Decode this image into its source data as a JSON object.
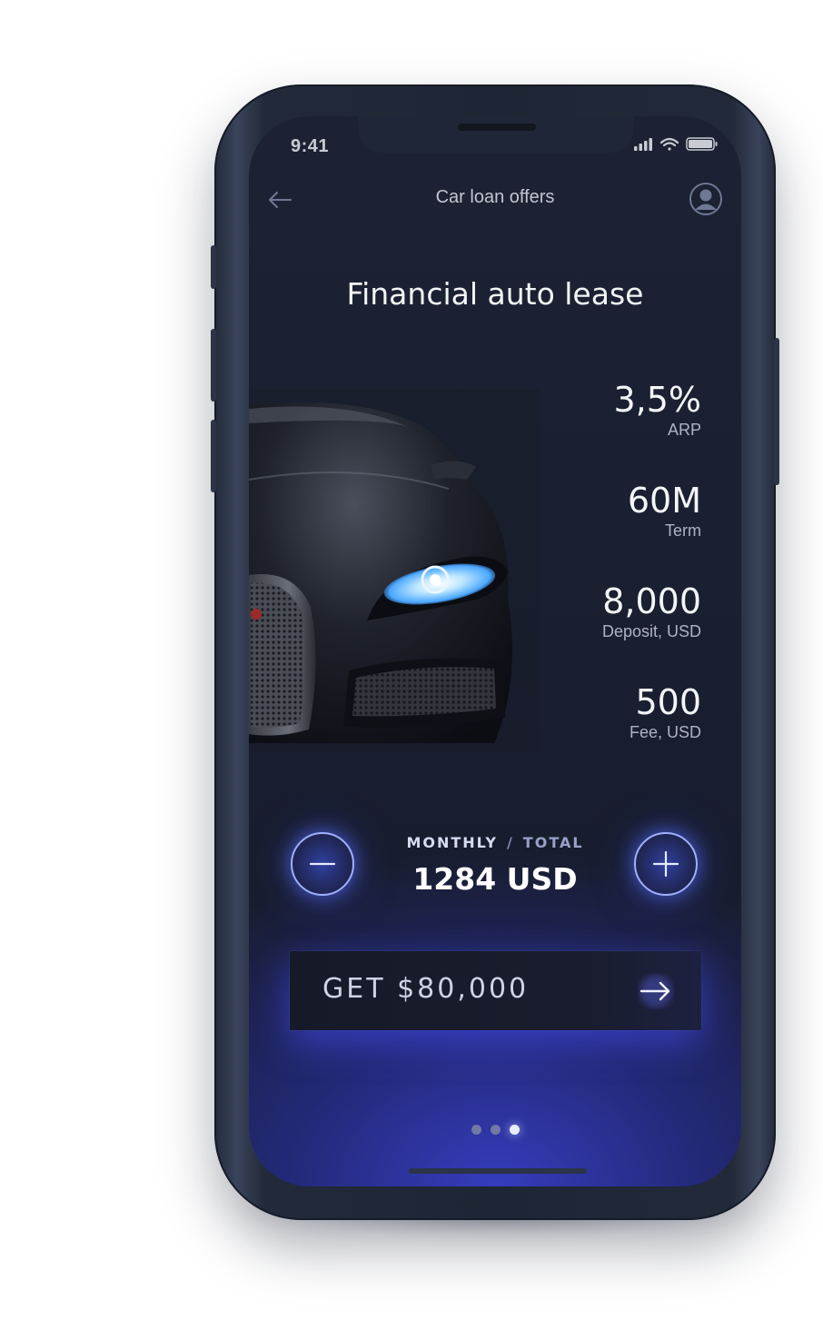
{
  "status_bar": {
    "time": "9:41"
  },
  "nav": {
    "title": "Car loan offers"
  },
  "headline": "Financial auto lease",
  "stats": [
    {
      "value": "3,5%",
      "label": "ARP"
    },
    {
      "value": "60M",
      "label": "Term"
    },
    {
      "value": "8,000",
      "label": "Deposit, USD"
    },
    {
      "value": "500",
      "label": "Fee, USD"
    }
  ],
  "payment": {
    "monthly_label": "MONTHLY",
    "separator": "/",
    "total_label": "TOTAL",
    "amount": "1284 USD"
  },
  "cta": {
    "label": "GET $80,000"
  },
  "pager": {
    "count": 3,
    "active_index": 2
  },
  "colors": {
    "accent": "#5a6cff",
    "background": "#1a2031",
    "glow": "#3a44c8"
  }
}
